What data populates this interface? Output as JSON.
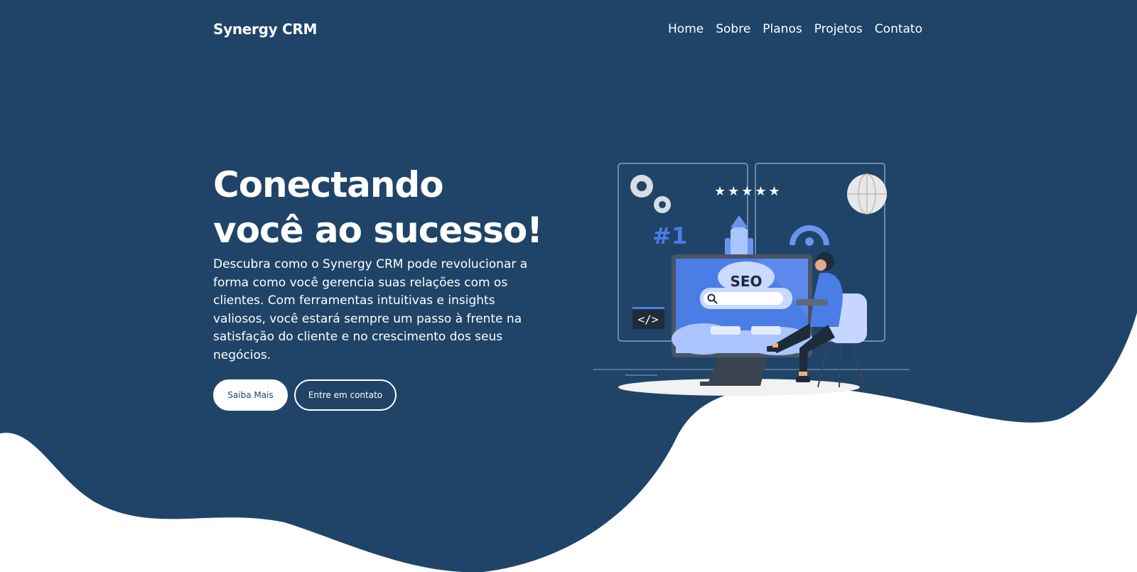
{
  "brand": {
    "name": "Synergy CRM"
  },
  "nav": {
    "items": [
      "Home",
      "Sobre",
      "Planos",
      "Projetos",
      "Contato"
    ]
  },
  "hero": {
    "title_line1": "Conectando",
    "title_line2": "você ao sucesso!",
    "description": "Descubra como o Synergy CRM pode revolucionar a forma como você gerencia suas relações com os clientes. Com ferramentas intuitivas e insights valiosos, você estará sempre um passo à frente na satisfação do cliente e no crescimento dos seus negócios.",
    "primary_button": "Saiba Mais",
    "secondary_button": "Entre em contato"
  },
  "illustration": {
    "monitor_text": "SEO",
    "badge_text": "#1",
    "code_text": "</>",
    "stars": "★★★★★"
  },
  "colors": {
    "background": "#1f4468",
    "accent": "#4b7de6",
    "light_accent": "#a9c4ff",
    "white": "#ffffff"
  }
}
